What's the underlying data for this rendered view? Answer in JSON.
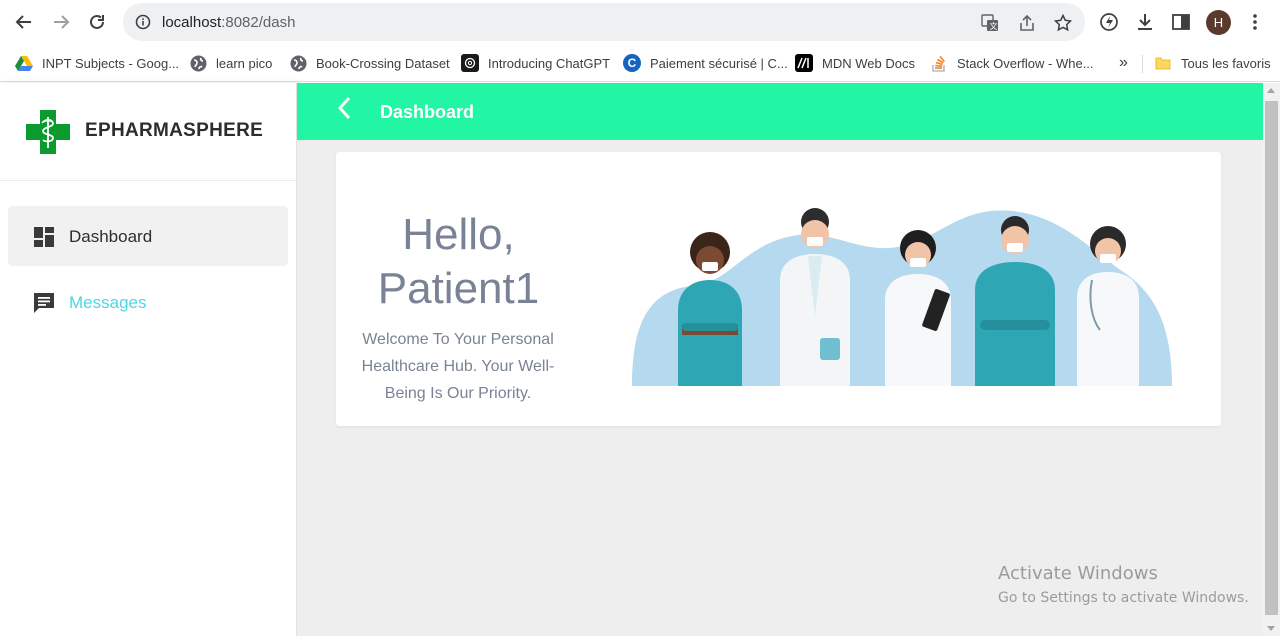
{
  "browser": {
    "url_host": "localhost",
    "url_port_path": ":8082/dash",
    "avatar_letter": "H",
    "bookmarks": [
      {
        "label": "INPT Subjects - Goog...",
        "icon": "google-drive-icon"
      },
      {
        "label": "learn pico",
        "icon": "globe-icon"
      },
      {
        "label": "Book-Crossing Dataset",
        "icon": "globe-icon"
      },
      {
        "label": "Introducing ChatGPT",
        "icon": "openai-icon"
      },
      {
        "label": "Paiement sécurisé | C...",
        "icon": "c-logo-icon"
      },
      {
        "label": "MDN Web Docs",
        "icon": "mdn-icon"
      },
      {
        "label": "Stack Overflow - Whe...",
        "icon": "stackoverflow-icon"
      }
    ],
    "overflow_label": "»",
    "all_bookmarks_label": "Tous les favoris"
  },
  "sidebar": {
    "brand": "EPHARMASPHERE",
    "items": [
      {
        "label": "Dashboard",
        "icon": "dashboard-icon",
        "active": true
      },
      {
        "label": "Messages",
        "icon": "chat-icon",
        "active": false
      }
    ]
  },
  "topbar": {
    "title": "Dashboard"
  },
  "card": {
    "greeting": "Hello, Patient1",
    "welcome": "Welcome To Your Personal Healthcare Hub. Your Well-Being Is Our Priority."
  },
  "watermark": {
    "line1": "Activate Windows",
    "line2": "Go to Settings to activate Windows."
  },
  "colors": {
    "accent": "#22f5a4",
    "brand_green": "#0a9a2e",
    "messages_text": "#4dd6e6",
    "dashboard_text": "#2d2d2d"
  }
}
